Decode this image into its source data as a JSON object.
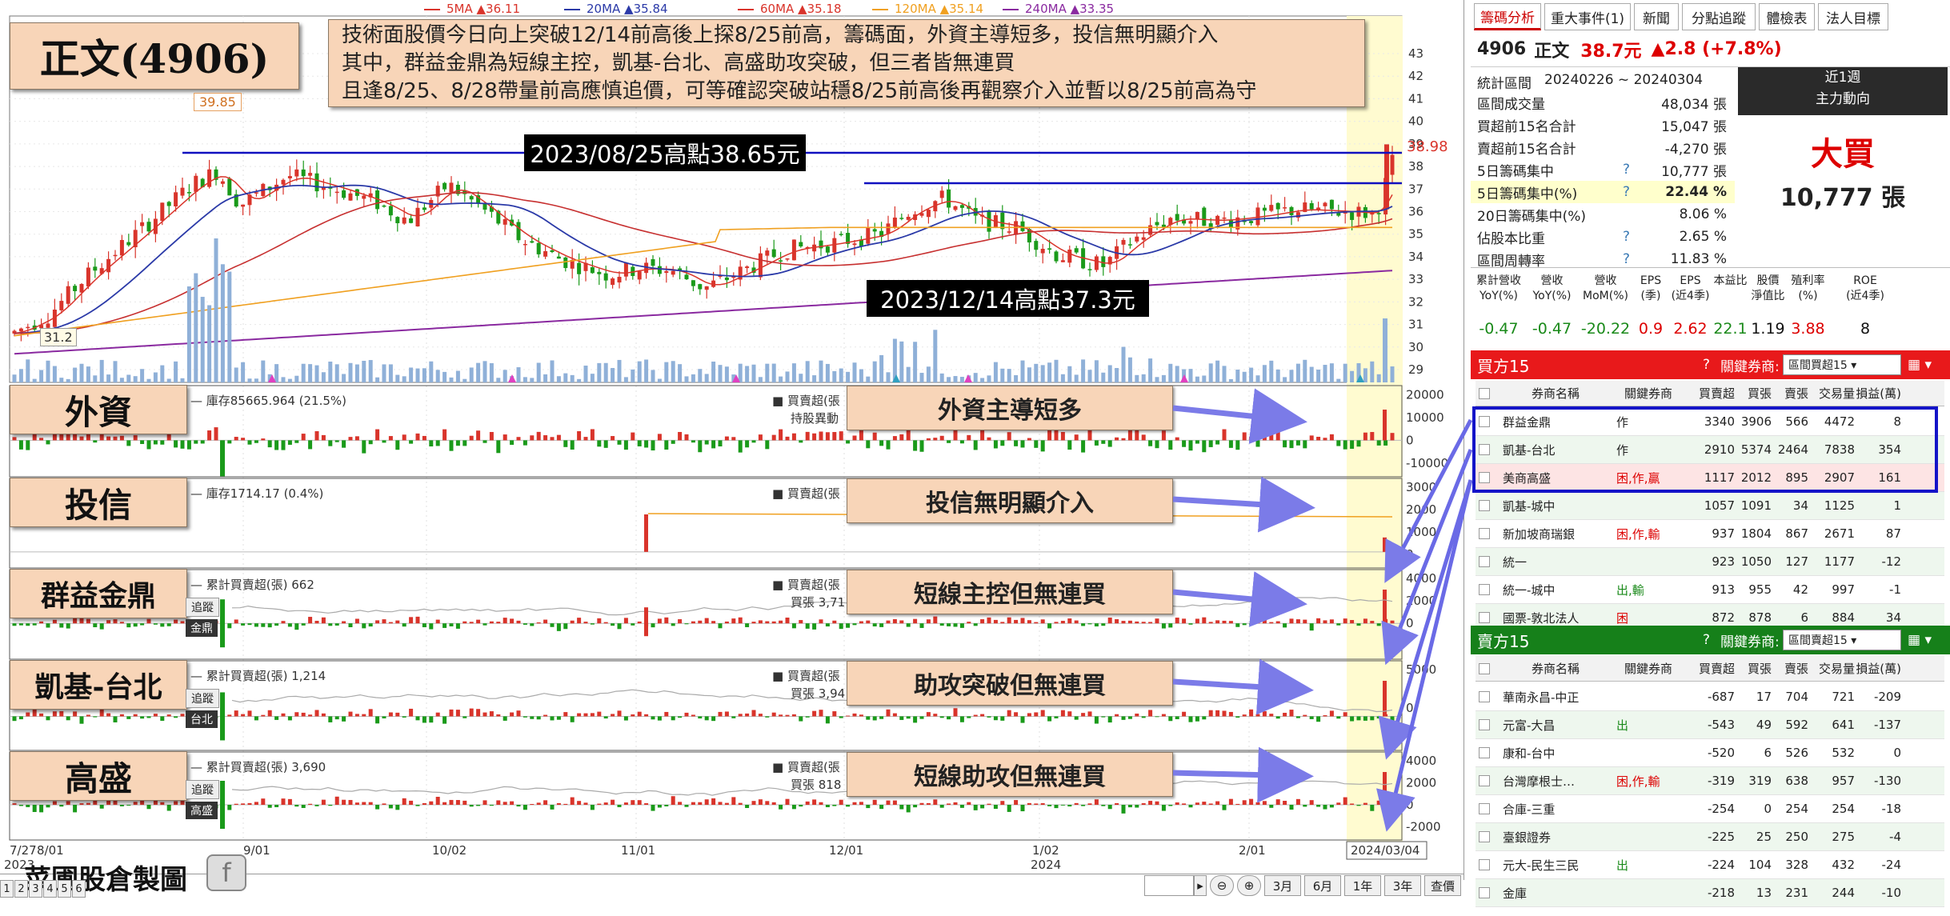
{
  "stock": {
    "code": "4906",
    "name": "正文",
    "title": "正文(4906)",
    "price": "38.7元",
    "change": "▲2.8 (+7.8%)"
  },
  "legend": [
    {
      "label": "5MA ▲36.11",
      "color": "#d9342b"
    },
    {
      "label": "20MA ▲35.84",
      "color": "#2b3aa8"
    },
    {
      "label": "60MA ▲35.18",
      "color": "#d9342b"
    },
    {
      "label": "120MA ▲35.14",
      "color": "#f0a020"
    },
    {
      "label": "240MA ▲33.35",
      "color": "#8a2aa0"
    }
  ],
  "note": [
    "技術面股價今日向上突破12/14前高後上探8/25前高，籌碼面，外資主導短多，投信無明顯介入",
    "其中，群益金鼎為短線主控，凱基-台北、高盛助攻突破，但三者皆無連買",
    "且逢8/25、8/28帶量前高應慎追價，可等確認突破站穩8/25前高後再觀察介入並暫以8/25前高為守"
  ],
  "annotations": {
    "high_0825": "2023/08/25高點38.65元",
    "high_1214": "2023/12/14高點37.3元",
    "peak_label": "39.85",
    "low_label": "31.2",
    "last_price": "38.98"
  },
  "y_axis_price": [
    "43",
    "42",
    "41",
    "40",
    "39",
    "38",
    "37",
    "36",
    "35",
    "34",
    "33",
    "32",
    "31",
    "30",
    "29"
  ],
  "x_axis": {
    "labels": [
      "7/27",
      "8/01",
      "9/01",
      "10/02",
      "11/01",
      "12/01",
      "1/02",
      "2/01",
      "2024/03/04"
    ],
    "years": [
      "2023",
      "2024"
    ]
  },
  "panels": [
    {
      "id": "foreign",
      "label": "外資",
      "info": "庫存85665.964 (21.5%)",
      "legend1": "買賣超(張",
      "legend2": "持股異動",
      "callout": "外資主導短多",
      "ticks": [
        "20000",
        "10000",
        "0",
        "-10000"
      ]
    },
    {
      "id": "trust",
      "label": "投信",
      "info": "庫存1714.17 (0.4%)",
      "legend1": "買賣超(張",
      "legend2": "",
      "callout": "投信無明顯介入",
      "ticks": [
        "3000",
        "2000",
        "1000",
        "0"
      ]
    },
    {
      "id": "capital",
      "label": "群益金鼎",
      "info": "累計買賣超(張) 662",
      "legend1": "買賣超(張",
      "legend2": "買張 3,71",
      "callout": "短線主控但無連買",
      "ticks": [
        "4000",
        "2000",
        "0"
      ],
      "btn": "追蹤",
      "sub": "金鼎"
    },
    {
      "id": "kgi",
      "label": "凱基-台北",
      "info": "累計買賣超(張) 1,214",
      "legend1": "買賣超(張",
      "legend2": "買張 3,94",
      "callout": "助攻突破但無連買",
      "ticks": [
        "5000",
        "0"
      ],
      "btn": "追蹤",
      "sub": "台北"
    },
    {
      "id": "gs",
      "label": "高盛",
      "info": "累計買賣超(張) 3,690",
      "legend1": "買賣超(張",
      "legend2": "買張 818",
      "callout": "短線助攻但無連買",
      "ticks": [
        "4000",
        "2000",
        "0",
        "-2000"
      ],
      "btn": "追蹤",
      "sub": "高盛"
    }
  ],
  "bottom": {
    "watermark": "菜圃股倉製圖",
    "page_nums": [
      "1",
      "2",
      "3",
      "4",
      "5",
      "6"
    ],
    "buttons": [
      "3月",
      "6月",
      "1年",
      "3年",
      "查價"
    ]
  },
  "tabs": [
    "籌碼分析",
    "重大事件(1)",
    "新聞",
    "分點追蹤",
    "體檢表",
    "法人目標"
  ],
  "stats": {
    "period_label": "統計區間",
    "period": "20240226 ~ 20240304",
    "rows": [
      {
        "label": "區間成交量",
        "val": "48,034 張",
        "hl": false,
        "q": false
      },
      {
        "label": "買超前15名合計",
        "val": "15,047 張",
        "hl": false,
        "q": false
      },
      {
        "label": "賣超前15名合計",
        "val": "-4,270 張",
        "hl": false,
        "q": false
      },
      {
        "label": "5日籌碼集中",
        "val": "10,777 張",
        "hl": false,
        "q": true
      },
      {
        "label": "5日籌碼集中(%)",
        "val": "22.44 %",
        "hl": true,
        "q": true
      },
      {
        "label": "20日籌碼集中(%)",
        "val": "8.06 %",
        "hl": false,
        "q": false
      },
      {
        "label": "佔股本比重",
        "val": "2.65 %",
        "hl": false,
        "q": true
      },
      {
        "label": "區間周轉率",
        "val": "11.83 %",
        "hl": false,
        "q": true
      }
    ],
    "side_title": "近1週",
    "side_sub": "主力動向",
    "side_main": "大買",
    "side_val": "10,777 張"
  },
  "fin": {
    "headers": [
      "累計營收\nYoY(%)",
      "營收\nYoY(%)",
      "營收\nMoM(%)",
      "EPS\n(季)",
      "EPS\n(近4季)",
      "本益比",
      "股價\n淨值比",
      "殖利率\n(%)",
      "ROE\n(近4季)"
    ],
    "values": [
      "-0.47",
      "-0.47",
      "-20.22",
      "0.9",
      "2.62",
      "22.1",
      "1.19",
      "3.88",
      "8"
    ],
    "colors": [
      "#1a8a1a",
      "#1a8a1a",
      "#1a8a1a",
      "#d00",
      "#d00",
      "#1a8a1a",
      "#111",
      "#d00",
      "#111"
    ]
  },
  "buy": {
    "title": "買方15",
    "key_label": "關鍵券商:",
    "select": "區間買超15",
    "cols": [
      "券商名稱",
      "關鍵券商",
      "買賣超",
      "買張",
      "賣張",
      "交易量",
      "損益(萬)"
    ],
    "rows": [
      [
        "群益金鼎",
        "作",
        "3340",
        "3906",
        "566",
        "4472",
        "8"
      ],
      [
        "凱基-台北",
        "作",
        "2910",
        "5374",
        "2464",
        "7838",
        "354"
      ],
      [
        "美商高盛",
        "困,作,贏",
        "1117",
        "2012",
        "895",
        "2907",
        "161"
      ],
      [
        "凱基-城中",
        "",
        "1057",
        "1091",
        "34",
        "1125",
        "1"
      ],
      [
        "新加坡商瑞銀",
        "困,作,輸",
        "937",
        "1804",
        "867",
        "2671",
        "87"
      ],
      [
        "統一",
        "",
        "923",
        "1050",
        "127",
        "1177",
        "-12"
      ],
      [
        "統一-城中",
        "出,輸",
        "913",
        "955",
        "42",
        "997",
        "-1"
      ],
      [
        "國票-敦北法人",
        "困",
        "872",
        "878",
        "6",
        "884",
        "34"
      ]
    ]
  },
  "sell": {
    "title": "賣方15",
    "key_label": "關鍵券商:",
    "select": "區間賣超15",
    "cols": [
      "券商名稱",
      "關鍵券商",
      "買賣超",
      "買張",
      "賣張",
      "交易量",
      "損益(萬)"
    ],
    "rows": [
      [
        "華南永昌-中正",
        "",
        "-687",
        "17",
        "704",
        "721",
        "-209"
      ],
      [
        "元富-大昌",
        "出",
        "-543",
        "49",
        "592",
        "641",
        "-137"
      ],
      [
        "康和-台中",
        "",
        "-520",
        "6",
        "526",
        "532",
        "0"
      ],
      [
        "台灣摩根士…",
        "困,作,輸",
        "-319",
        "319",
        "638",
        "957",
        "-130"
      ],
      [
        "合庫-三重",
        "",
        "-254",
        "0",
        "254",
        "254",
        "-18"
      ],
      [
        "臺銀證券",
        "",
        "-225",
        "25",
        "250",
        "275",
        "-4"
      ],
      [
        "元大-民生三民",
        "出",
        "-224",
        "104",
        "328",
        "432",
        "-24"
      ],
      [
        "金庫",
        "",
        "-218",
        "13",
        "231",
        "244",
        "-10"
      ]
    ]
  },
  "colors": {
    "up": "#d9342b",
    "down": "#1a9a1a",
    "ma20": "#2b3aa8",
    "ma120": "#f0a020",
    "ma240": "#8a2aa0",
    "hline": "#1010c0",
    "buy_head": "#e8191b",
    "sell_head": "#16801a",
    "highlight": "#ffffcc"
  }
}
